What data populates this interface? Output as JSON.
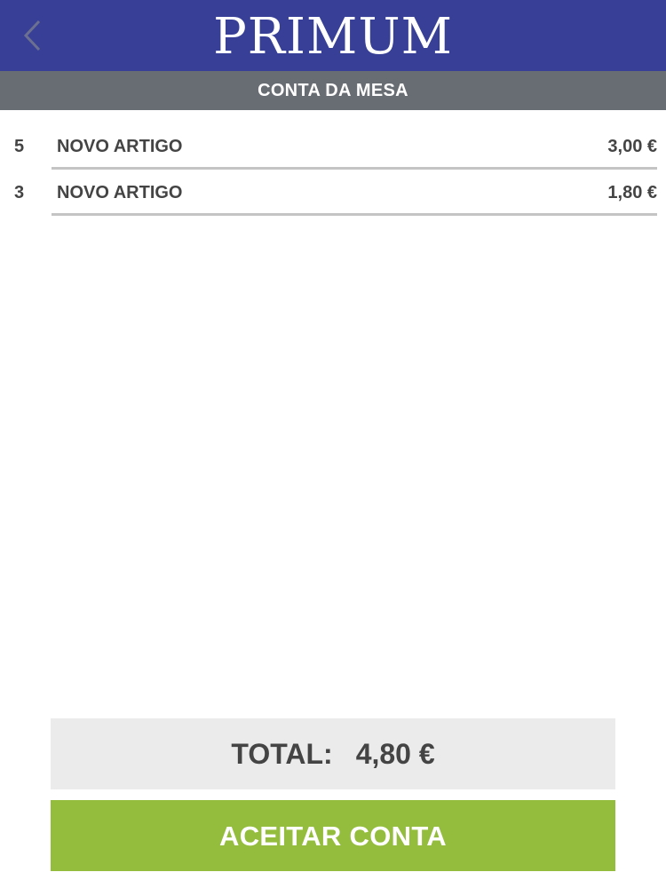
{
  "header": {
    "brand": "PRIMUM",
    "back_icon": "chevron-left-icon",
    "background_color": "#383f97"
  },
  "subheader": {
    "title": "CONTA DA MESA",
    "background_color": "#686d74"
  },
  "items": [
    {
      "qty": "5",
      "name": "NOVO ARTIGO",
      "price": "3,00 €"
    },
    {
      "qty": "3",
      "name": "NOVO ARTIGO",
      "price": "1,80 €"
    }
  ],
  "total": {
    "label": "TOTAL:",
    "value": "4,80 €"
  },
  "accept_button": {
    "label": "ACEITAR CONTA",
    "color": "#95bd3d"
  }
}
